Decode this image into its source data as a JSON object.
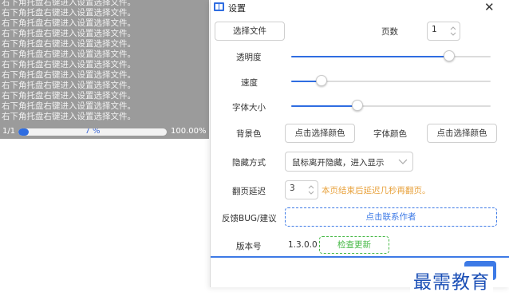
{
  "reader": {
    "lines": [
      "右下角托盘右键进入设置选择文件。",
      "右下角托盘右键进入设置选择文件。",
      "右下角托盘右键进入设置选择文件。",
      "右下角托盘右键进入设置选择文件。",
      "右下角托盘右键进入设置选择文件。",
      "右下角托盘右键进入设置选择文件。",
      "右下角托盘右键进入设置选择文件。",
      "右下角托盘右键进入设置选择文件。",
      "右下角托盘右键进入设置选择文件。",
      "右下角托盘右键进入设置选择文件。",
      "右下角托盘右键进入设置选择文件。",
      "右下角托盘右键进入设置选择文件。"
    ],
    "page_indicator": "1/1",
    "progress_text": "7 %",
    "progress_fraction": 0.07,
    "total_text": "100.00%"
  },
  "dialog": {
    "title": "设置",
    "close_symbol": "✕",
    "choose_file_label": "选择文件",
    "pages_label": "页数",
    "pages_value": "1",
    "opacity_label": "透明度",
    "opacity_level": 0.79,
    "speed_label": "速度",
    "speed_level": 0.15,
    "font_size_label": "字体大小",
    "font_size_level": 0.33,
    "bg_color_label": "背景色",
    "bg_color_button": "点击选择颜色",
    "font_color_label": "字体颜色",
    "font_color_button": "点击选择颜色",
    "hide_mode_label": "隐藏方式",
    "hide_mode_value": "鼠标离开隐藏，进入显示",
    "page_delay_label": "翻页延迟",
    "page_delay_value": "3",
    "page_delay_hint": "本页结束后延迟几秒再翻页。",
    "feedback_label": "反馈BUG/建议",
    "contact_button": "点击联系作者",
    "version_label": "版本号",
    "version_value": "1.3.0.0",
    "update_button": "检查更新"
  },
  "watermark": "最需教育",
  "colors": {
    "accent": "#2f6de1",
    "hint": "#e8a23d",
    "update_green": "#46b946",
    "overlay_gray": "#9b9b9b"
  }
}
